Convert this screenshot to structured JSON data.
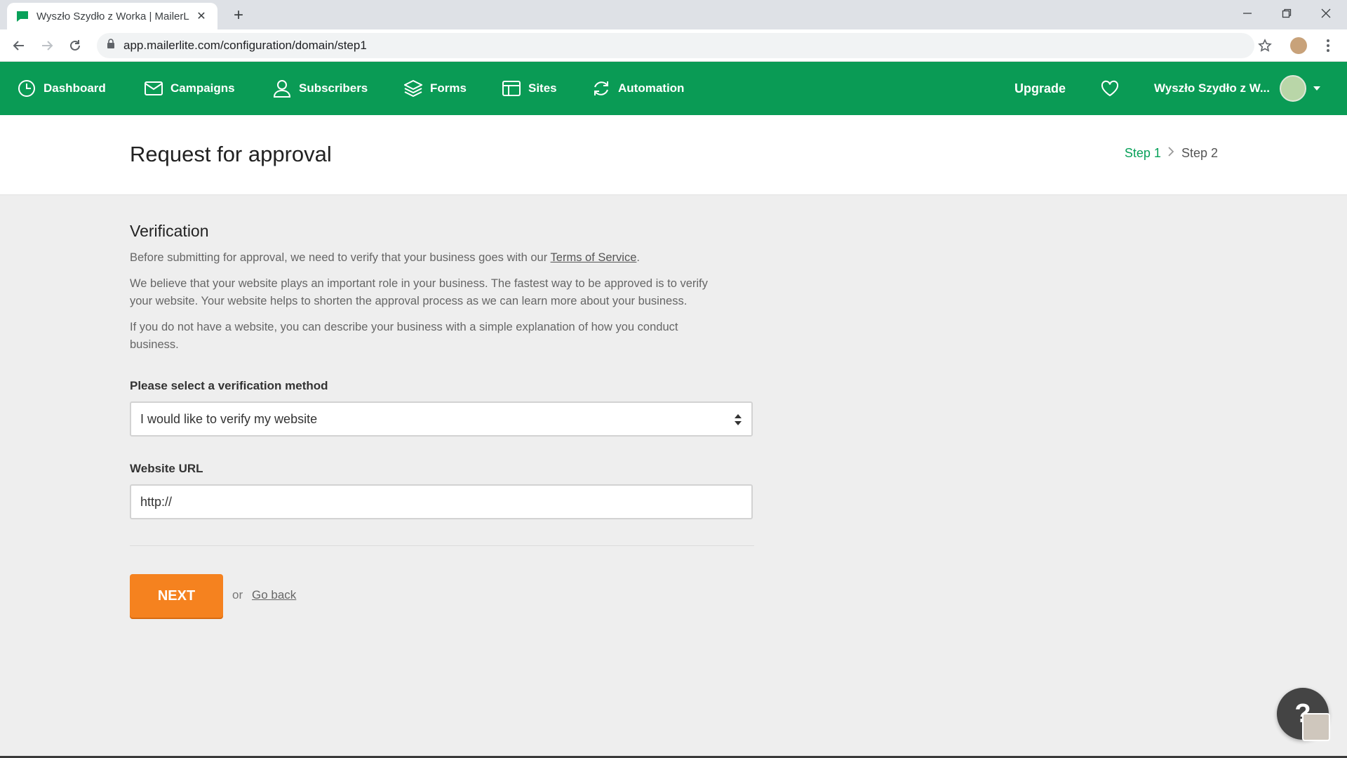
{
  "browser": {
    "tab_title": "Wyszło Szydło z Worka | MailerLi",
    "url": "app.mailerlite.com/configuration/domain/step1"
  },
  "nav": {
    "items": [
      {
        "label": "Dashboard",
        "icon": "dashboard-icon"
      },
      {
        "label": "Campaigns",
        "icon": "envelope-icon"
      },
      {
        "label": "Subscribers",
        "icon": "user-icon"
      },
      {
        "label": "Forms",
        "icon": "layers-icon"
      },
      {
        "label": "Sites",
        "icon": "browser-window-icon"
      },
      {
        "label": "Automation",
        "icon": "refresh-icon"
      }
    ],
    "upgrade": "Upgrade",
    "account_name": "Wyszło Szydło z W..."
  },
  "header": {
    "title": "Request for approval",
    "step1": "Step 1",
    "step2": "Step 2"
  },
  "verification": {
    "title": "Verification",
    "p1_text": "Before submitting for approval, we need to verify that your business goes with our ",
    "p1_link": "Terms of Service",
    "p1_end": ".",
    "p2_line1": "We believe that your website plays an important role in your business. The fastest way to be approved is to verify",
    "p2_line2": "your website. Your website helps to shorten the approval process as we can learn more about your business.",
    "p3_line1": "If you do not have a website, you can describe your business with a simple explanation of how you conduct",
    "p3_line2": "business.",
    "method_label": "Please select a verification method",
    "method_value": "I would like to verify my website",
    "url_label": "Website URL",
    "url_value": "http://"
  },
  "actions": {
    "next": "NEXT",
    "or": "or",
    "go_back": "Go back"
  },
  "colors": {
    "brand_green": "#0a9b55",
    "accent_orange": "#f5821f"
  }
}
